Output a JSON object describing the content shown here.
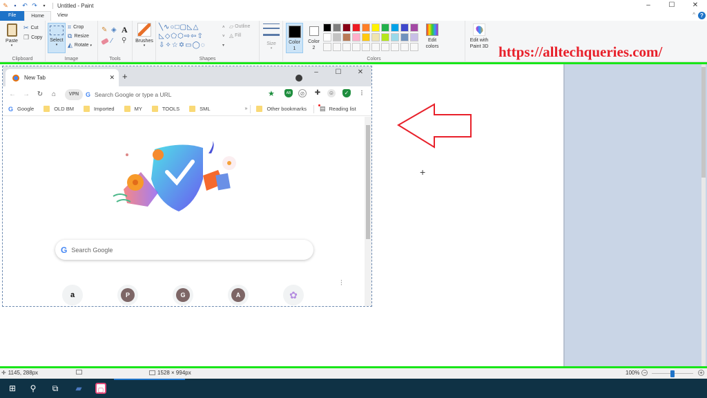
{
  "app": {
    "title": "Untitled - Paint",
    "quick_access": [
      "save-icon",
      "undo-icon",
      "redo-icon",
      "customize-icon"
    ],
    "window_controls": {
      "minimize": "–",
      "maximize": "☐",
      "close": "✕"
    }
  },
  "ribbon": {
    "tabs": [
      {
        "label": "File"
      },
      {
        "label": "Home"
      },
      {
        "label": "View"
      }
    ],
    "help": "?",
    "clipboard": {
      "paste": "Paste",
      "cut": "Cut",
      "copy": "Copy",
      "label": "Clipboard"
    },
    "image": {
      "select": "Select",
      "crop": "Crop",
      "resize": "Resize",
      "rotate": "Rotate",
      "label": "Image"
    },
    "tools": {
      "label": "Tools",
      "text": "A"
    },
    "brushes": {
      "label": "Brushes"
    },
    "shapes": {
      "label": "Shapes",
      "outline": "Outline",
      "fill": "Fill"
    },
    "size": {
      "label": "Size"
    },
    "colors": {
      "color1": "Color\n1",
      "color1_label": "Color 1",
      "color2_label": "Color 2",
      "color1_value": "#000000",
      "color2_value": "#ffffff",
      "label": "Colors",
      "edit_colors": "Edit colors",
      "edit_paint3d": "Edit with Paint 3D",
      "palette_row1": [
        "#000000",
        "#7f7f7f",
        "#880015",
        "#ed1c24",
        "#ff7f27",
        "#fff200",
        "#22b14c",
        "#00a2e8",
        "#3f48cc",
        "#a349a4"
      ],
      "palette_row2": [
        "#ffffff",
        "#c3c3c3",
        "#b97a57",
        "#ffaec9",
        "#ffc90e",
        "#efe4b0",
        "#b5e61d",
        "#99d9ea",
        "#7092be",
        "#c8bfe7"
      ]
    }
  },
  "watermark": "https://alltechqueries.com/",
  "chrome": {
    "tab_title": "New Tab",
    "new_tab": "+",
    "omnibox_placeholder": "Search Google or type a URL",
    "vpn": "VPN",
    "bookmarks": [
      "Google",
      "OLD BM",
      "Imported",
      "MY",
      "TOOLS",
      "SML"
    ],
    "more_bookmarks": "»",
    "other_bookmarks": "Other bookmarks",
    "reading_list": "Reading list",
    "search_placeholder": "Search Google",
    "shortcuts": [
      "a",
      "P",
      "G",
      "A",
      "✿"
    ],
    "extensions": [
      "adblock-icon",
      "sync-icon",
      "extensions-puzzle-icon",
      "profile-icon",
      "shield-icon",
      "menu-icon"
    ]
  },
  "statusbar": {
    "cursor_pos": "1145, 288px",
    "canvas_size": "1528 × 994px",
    "zoom": "100%",
    "zoom_level_percent": 100
  },
  "colors": {
    "accent": "#1e73c8",
    "green_border": "#19e619",
    "watermark": "#e8202a",
    "arrow": "#e8202a"
  }
}
